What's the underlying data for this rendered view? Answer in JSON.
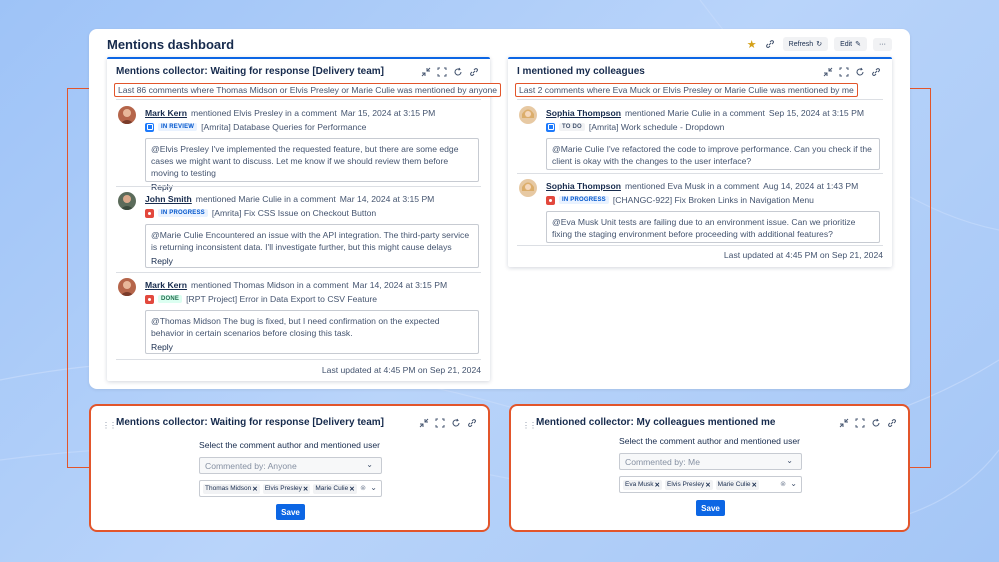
{
  "dashboard": {
    "title": "Mentions dashboard",
    "refresh_label": "Refresh",
    "edit_label": "Edit",
    "more_label": "···"
  },
  "gadget_left": {
    "title": "Mentions collector: Waiting for response [Delivery team]",
    "summary": "Last 86 comments where Thomas Midson or Elvis Presley or Marie Culie was mentioned by anyone",
    "entries": [
      {
        "author": "Mark Kern",
        "action": "mentioned Elvis Presley in a comment",
        "time": "Mar 15, 2024 at 3:15 PM",
        "issue_type": "task",
        "status": "IN REVIEW",
        "issue": "[Amrita] Database Queries for Performance",
        "comment": "@Elvis Presley I've implemented the requested feature, but there are some edge cases we might want to discuss. Let me know if we should review them before moving to testing",
        "reply": "Reply"
      },
      {
        "author": "John Smith",
        "action": "mentioned Marie Culie in a comment",
        "time": "Mar 14, 2024 at 3:15 PM",
        "issue_type": "bug",
        "status": "IN PROGRESS",
        "issue": "[Amrita] Fix CSS Issue on Checkout Button",
        "comment": "@Marie Culie Encountered an issue with the API integration. The third-party service is returning inconsistent data. I'll investigate further, but this might cause delays",
        "reply": "Reply"
      },
      {
        "author": "Mark Kern",
        "action": "mentioned Thomas Midson in a comment",
        "time": "Mar 14, 2024 at 3:15 PM",
        "issue_type": "bug",
        "status": "DONE",
        "issue": "[RPT Project] Error in Data Export to CSV Feature",
        "comment": "@Thomas Midson The bug is fixed, but I need confirmation on the expected behavior in certain scenarios before closing this task.",
        "reply": "Reply"
      }
    ],
    "updated": "Last updated at 4:45 PM on Sep 21, 2024"
  },
  "gadget_right": {
    "title": "I mentioned my colleagues",
    "summary": "Last 2 comments where Eva Muck or Elvis Presley or Marie Culie was mentioned by me",
    "entries": [
      {
        "author": "Sophia Thompson",
        "action": "mentioned Marie Culie in a comment",
        "time": "Sep 15, 2024 at 3:15 PM",
        "issue_type": "task",
        "status": "TO DO",
        "issue": "[Amrita] Work schedule - Dropdown",
        "comment": "@Marie Culie I've refactored the code to improve performance. Can you check if the client is okay with the changes to the user interface?"
      },
      {
        "author": "Sophia Thompson",
        "action": "mentioned Eva Musk in a comment",
        "time": "Aug 14, 2024 at 1:43 PM",
        "issue_type": "bug",
        "status": "IN PROGRESS",
        "issue": "[CHANGC-922] Fix Broken Links in Navigation Menu",
        "comment": "@Eva Musk Unit tests are failing due to an environment issue. Can we prioritize fixing the staging environment before proceeding with additional features?"
      }
    ],
    "updated": "Last updated at 4:45 PM on Sep 21, 2024"
  },
  "config_left": {
    "title": "Mentions collector: Waiting for response [Delivery team]",
    "subtitle": "Select the comment author and mentioned user",
    "author_select": "Commented by: Anyone",
    "tags": [
      "Thomas Midson",
      "Elvis Presley",
      "Marie Culie"
    ],
    "save_label": "Save"
  },
  "config_right": {
    "title": "Mentioned collector: My colleagues mentioned me",
    "subtitle": "Select the comment author and mentioned user",
    "author_select": "Commented by: Me",
    "tags": [
      "Eva Musk",
      "Elvis Presley",
      "Marie Culie"
    ],
    "save_label": "Save"
  },
  "colors": {
    "accent": "#0c66e4",
    "highlight": "#e2552b",
    "background": "#a9c9f7"
  }
}
